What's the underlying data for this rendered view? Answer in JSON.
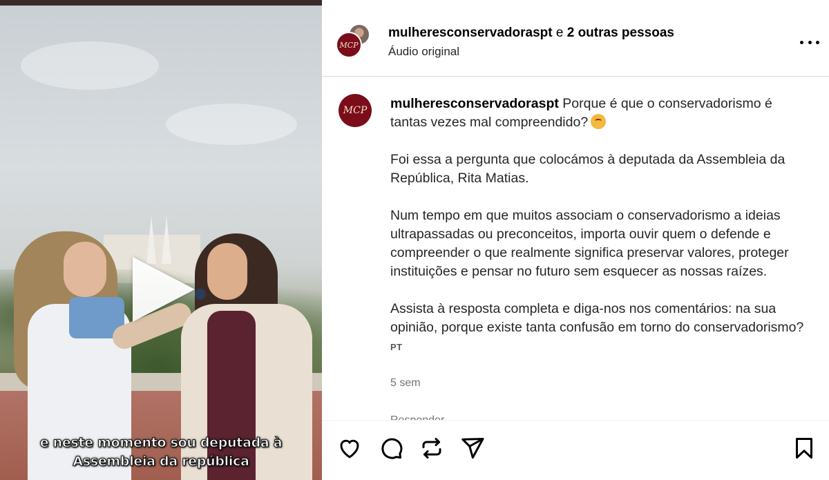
{
  "video": {
    "caption_line1": "e neste momento sou deputada à",
    "caption_line2": "Assembleia da república"
  },
  "header": {
    "username": "mulheresconservadoraspt",
    "connector": "e",
    "others": "2 outras pessoas",
    "audio": "Áudio original",
    "logo_text": "MCP"
  },
  "post": {
    "username": "mulheresconservadoraspt",
    "line1": "Porque é que o conservadorismo é tantas vezes mal compreendido?",
    "paragraph2": "Foi essa a pergunta que colocámos à deputada da Assembleia da República, Rita Matias.",
    "paragraph3": "Num tempo em que muitos associam o conservadorismo a ideias ultrapassadas ou preconceitos, importa ouvir quem o defende e compreender o que realmente significa preservar valores, proteger instituições e pensar no futuro sem esquecer as nossas raízes.",
    "paragraph4": "Assista à resposta completa e diga-nos nos comentários: na sua opinião, porque existe tanta confusão em torno do conservadorismo?",
    "lang_tag": "PT",
    "time": "5 sem",
    "reply_partial": "Responder"
  },
  "icons": {
    "more": "more-horizontal-icon",
    "like": "heart-icon",
    "comment": "comment-icon",
    "repost": "repost-icon",
    "share": "paper-plane-icon",
    "save": "bookmark-icon",
    "play": "play-icon"
  },
  "colors": {
    "brand_logo": "#7b0d1a",
    "text_muted": "#737373",
    "divider": "#dbdbdb"
  }
}
